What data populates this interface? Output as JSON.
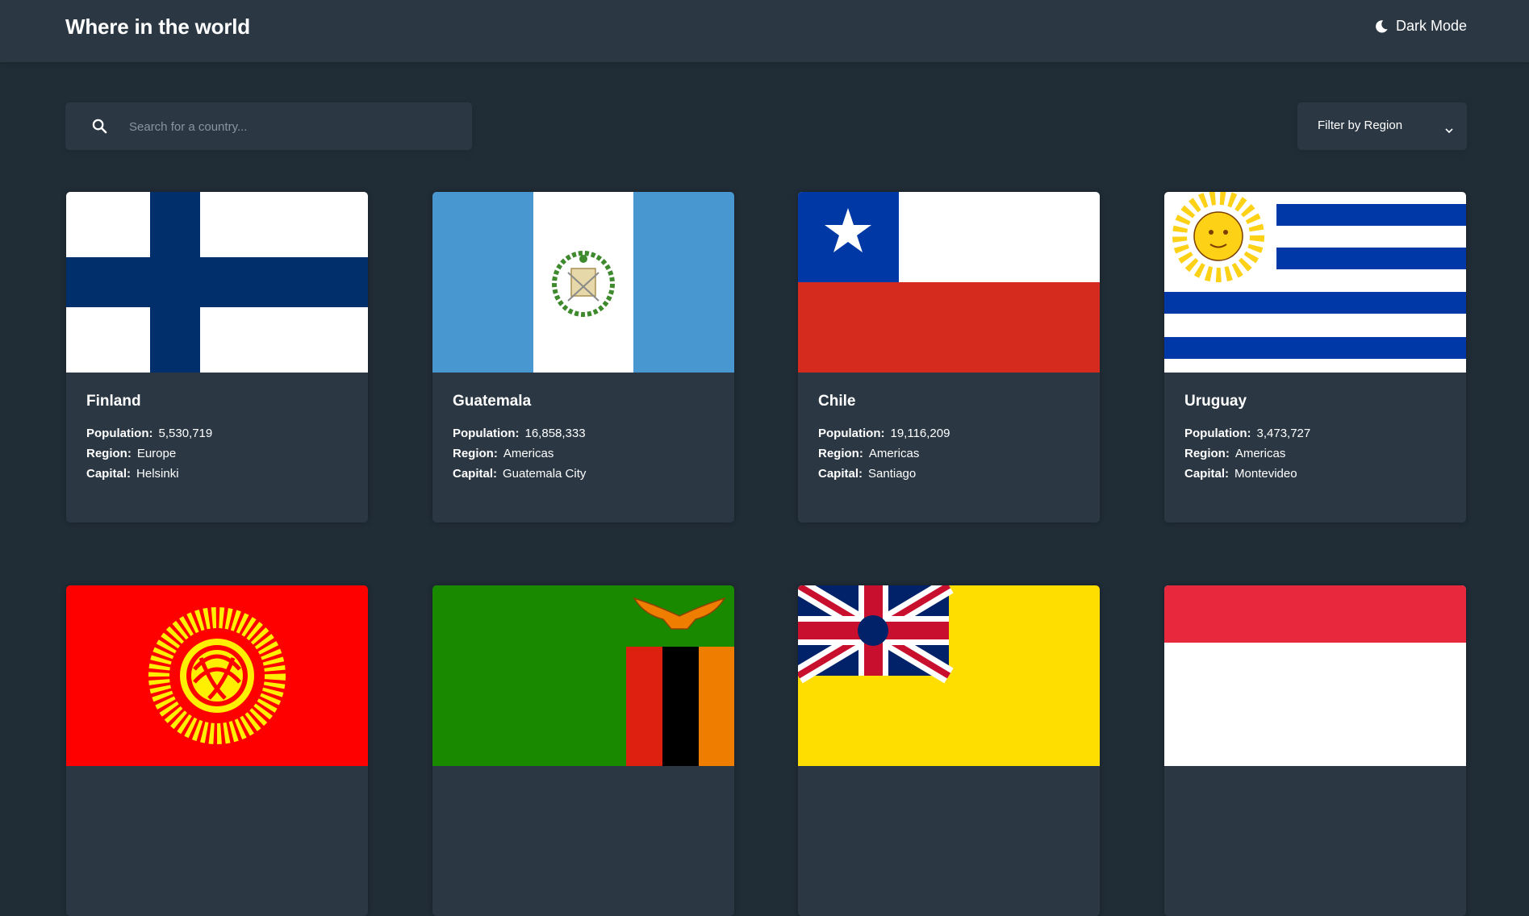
{
  "header": {
    "title": "Where in the world",
    "mode_label": "Dark Mode",
    "mode_icon": "moon-icon"
  },
  "search": {
    "placeholder": "Search for a country...",
    "value": "",
    "icon": "search-icon"
  },
  "filter": {
    "label": "Filter by Region",
    "icon": "chevron-down-icon"
  },
  "labels": {
    "population": "Population:",
    "region": "Region:",
    "capital": "Capital:"
  },
  "countries": [
    {
      "name": "Finland",
      "population": "5,530,719",
      "region": "Europe",
      "capital": "Helsinki",
      "flag": "finland-flag"
    },
    {
      "name": "Guatemala",
      "population": "16,858,333",
      "region": "Americas",
      "capital": "Guatemala City",
      "flag": "guatemala-flag"
    },
    {
      "name": "Chile",
      "population": "19,116,209",
      "region": "Americas",
      "capital": "Santiago",
      "flag": "chile-flag"
    },
    {
      "name": "Uruguay",
      "population": "3,473,727",
      "region": "Americas",
      "capital": "Montevideo",
      "flag": "uruguay-flag"
    },
    {
      "flag": "kyrgyzstan-flag"
    },
    {
      "flag": "zambia-flag"
    },
    {
      "flag": "niue-flag"
    },
    {
      "flag": "indonesia-flag"
    }
  ],
  "colors": {
    "background": "#202c36",
    "element": "#2b3844",
    "text": "#ffffff",
    "placeholder": "#8a949e"
  }
}
